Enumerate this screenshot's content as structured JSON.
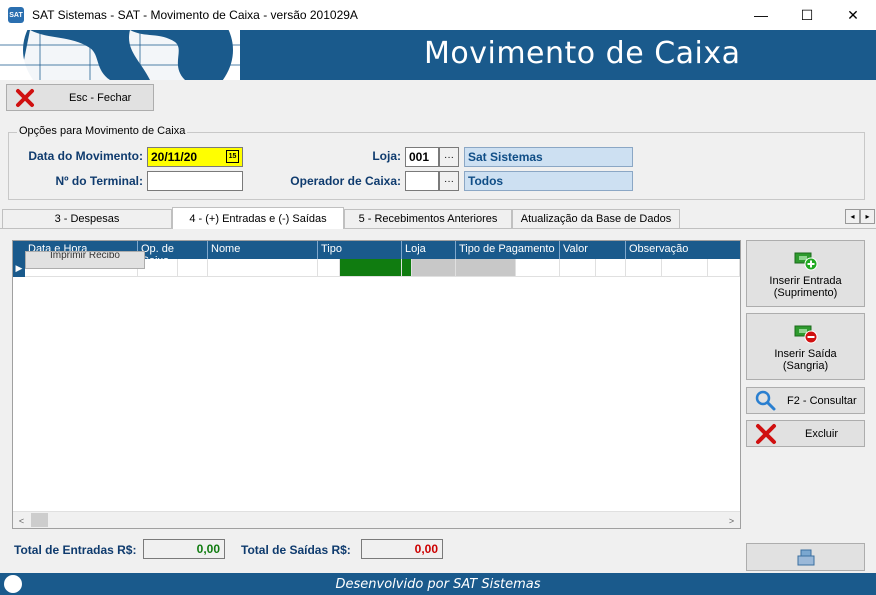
{
  "window": {
    "title": "SAT Sistemas - SAT - Movimento de Caixa - versão 201029A",
    "app_icon": "SAT",
    "minimize": "—",
    "maximize": "☐",
    "close": "✕"
  },
  "banner": {
    "title": "Movimento de Caixa"
  },
  "toolbar": {
    "close_label": "Esc - Fechar"
  },
  "options": {
    "group_title": "Opções para Movimento de Caixa",
    "date_label": "Data do Movimento:",
    "date_value": "20/11/20",
    "calendar_icon": "15",
    "terminal_label": "Nº do Terminal:",
    "terminal_value": "",
    "store_label": "Loja:",
    "store_code": "001",
    "store_name": "Sat Sistemas",
    "operator_label": "Operador de Caixa:",
    "operator_code": "",
    "operator_name": "Todos",
    "lookup_label": "···"
  },
  "tabs": [
    {
      "label": "3 - Despesas"
    },
    {
      "label": "4 - (+) Entradas e (-) Saídas"
    },
    {
      "label": "5 - Recebimentos Anteriores"
    },
    {
      "label": "Atualização da Base de Dados"
    }
  ],
  "tab_scroll": {
    "left": "◂",
    "right": "▸"
  },
  "grid": {
    "columns": [
      "Data e Hora",
      "Op. de Caixa",
      "Nome",
      "Tipo",
      "Loja",
      "Tipo de Pagamento",
      "Valor",
      "Observação"
    ],
    "row_indicator": "▶",
    "print_button": "Imprimir Recibo",
    "scroll_left": "<",
    "scroll_right": ">"
  },
  "actions": {
    "insert_entry": {
      "line1": "Inserir Entrada",
      "line2": "(Suprimento)"
    },
    "insert_exit": {
      "line1": "Inserir Saída",
      "line2": "(Sangria)"
    },
    "consult": "F2 - Consultar",
    "delete": "Excluir"
  },
  "totals": {
    "entries_label": "Total de Entradas R$:",
    "entries_value": "0,00",
    "exits_label": "Total de Saídas R$:",
    "exits_value": "0,00"
  },
  "footer": {
    "text": "Desenvolvido por SAT Sistemas"
  },
  "colors": {
    "brand_blue": "#1a5a8c",
    "green": "#107c10",
    "red": "#cc0000",
    "highlight": "#ffff00"
  }
}
